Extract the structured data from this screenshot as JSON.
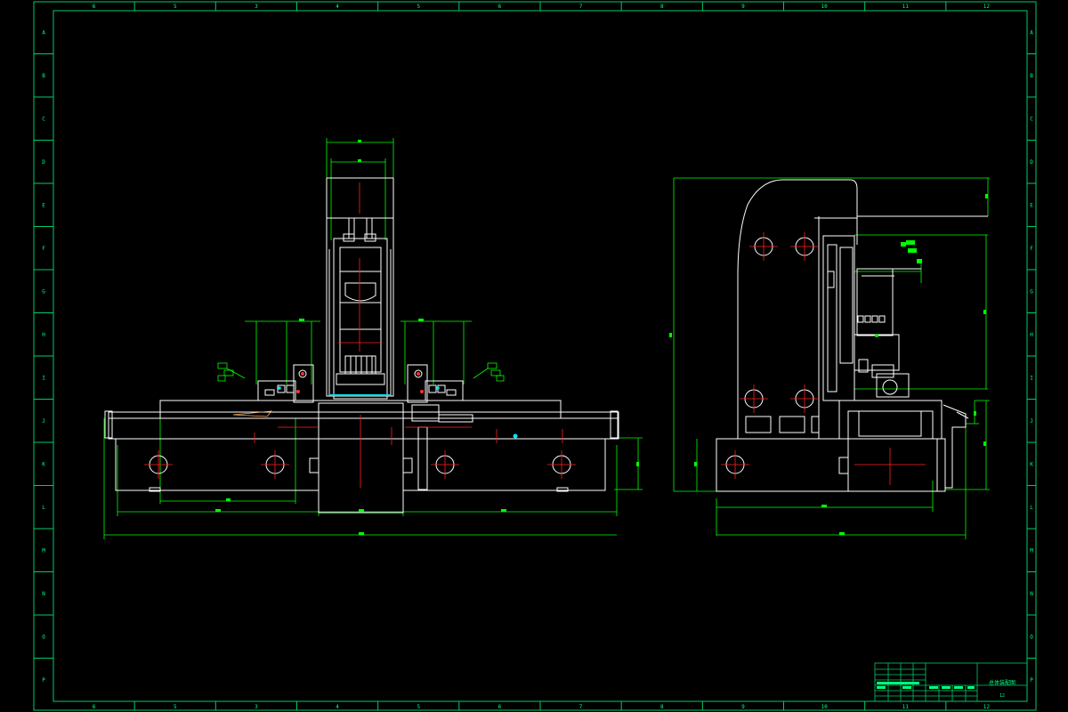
{
  "sheet": {
    "background": "#000000",
    "frame_color": "#00cc66",
    "outline_color": "#ffffff",
    "dimension_color": "#00ff00",
    "centerline_color": "#ff2020",
    "column_labels": [
      "6",
      "5",
      "3",
      "4",
      "5",
      "6",
      "7",
      "8",
      "9",
      "10",
      "11",
      "12"
    ],
    "row_labels": [
      "A",
      "B",
      "C",
      "D",
      "E",
      "F",
      "G",
      "H",
      "I",
      "J",
      "K",
      "L",
      "M",
      "N",
      "O",
      "P"
    ]
  },
  "title_block": {
    "drawing_name": "总体装配图",
    "sheet_number": "12"
  }
}
